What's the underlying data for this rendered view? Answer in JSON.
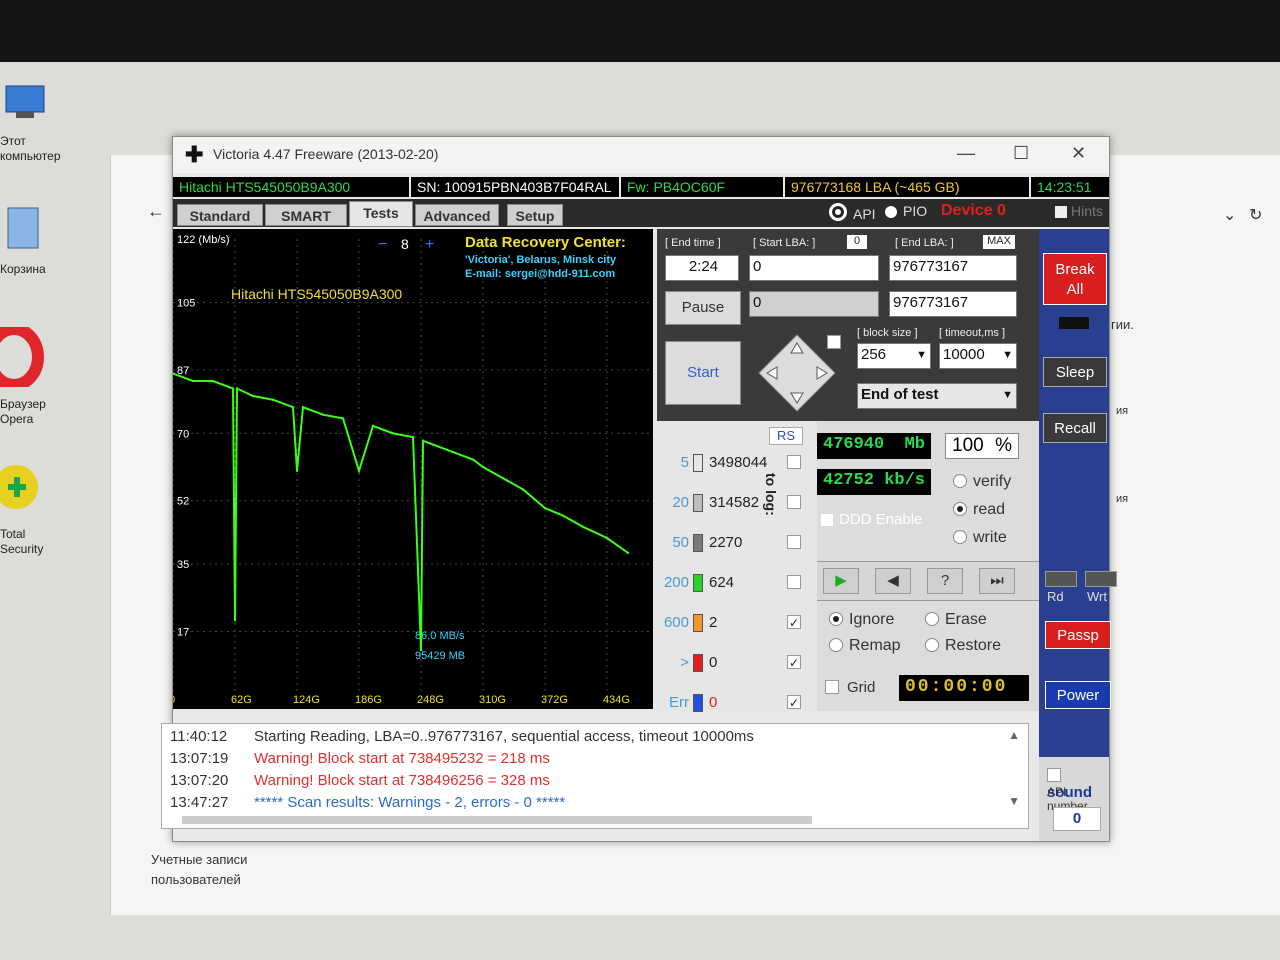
{
  "desktop": {
    "icons": [
      {
        "label": "Этот компьютер",
        "icon": "computer-icon"
      },
      {
        "label": "Корзина",
        "icon": "recycle-bin-icon"
      },
      {
        "label": "Браузер Opera",
        "icon": "opera-icon"
      },
      {
        "label": "Total Security",
        "icon": "total-security-icon"
      }
    ]
  },
  "background_window": {
    "text_accounts": "Учетные записи\nпользователей",
    "text_gii": "гии.",
    "text_ya1": "ия",
    "text_ya2": "ия"
  },
  "window": {
    "title": "Victoria 4.47  Freeware (2013-02-20)",
    "controls": {
      "minimize": "—",
      "maximize": "☐",
      "close": "✕"
    }
  },
  "infobar": {
    "model": "Hitachi HTS545050B9A300",
    "serial": "SN: 100915PBN403B7F04RAL",
    "firmware": "Fw: PB4OC60F",
    "capacity": "976773168 LBA (~465 GB)",
    "time": "14:23:51"
  },
  "tabs": [
    "Standard",
    "SMART",
    "Tests",
    "Advanced",
    "Setup"
  ],
  "active_tab": "Tests",
  "mode": {
    "api": "API",
    "pio": "PIO",
    "device": "Device 0",
    "hints": "Hints"
  },
  "graph": {
    "ylabel": "122 (Mb/s)",
    "yticks": [
      "105",
      "87",
      "70",
      "52",
      "35",
      "17"
    ],
    "xticks": [
      "0",
      "62G",
      "124G",
      "186G",
      "248G",
      "310G",
      "372G",
      "434G"
    ],
    "counter": "8",
    "minus": "−",
    "plus": "+",
    "drive_label": "Hitachi HTS545050B9A300",
    "center_title": "Data Recovery Center:",
    "center_line1": "'Victoria', Belarus, Minsk city",
    "center_line2": "E-mail: sergei@hdd-911.com",
    "speed_readout": "86,0 MB/s",
    "mb_readout": "95429 MB",
    "line_color": "#39ff14"
  },
  "chart_data": {
    "type": "line",
    "title": "",
    "ylabel": "122 (Mb/s)",
    "xlabel": "",
    "xticks": [
      "0",
      "62G",
      "124G",
      "186G",
      "248G",
      "310G",
      "372G",
      "434G"
    ],
    "ylim": [
      0,
      122
    ],
    "x_unit": "G",
    "series": [
      {
        "x": [
          0,
          10,
          20,
          40,
          60,
          62,
          64,
          80,
          100,
          120,
          124,
          130,
          150,
          170,
          186,
          200,
          220,
          240,
          248,
          250,
          260,
          280,
          300,
          310,
          330,
          350,
          372,
          390,
          410,
          434,
          455
        ],
        "y": [
          86,
          85,
          84,
          84,
          82,
          20,
          82,
          80,
          79,
          77,
          60,
          77,
          75,
          74,
          60,
          72,
          70,
          69,
          12,
          68,
          67,
          65,
          63,
          61,
          58,
          55,
          50,
          48,
          45,
          42,
          38
        ]
      }
    ]
  },
  "controls": {
    "end_time_label": "[ End time ]",
    "end_time": "2:24",
    "start_lba_label": "[ Start LBA: ]",
    "start_lba_zero": "0",
    "end_lba_label": "[ End LBA: ]",
    "max": "MAX",
    "start_lba": "0",
    "end_lba": "976773167",
    "cur_lba": "0",
    "cur_end_lba": "976773167",
    "pause": "Pause",
    "start": "Start",
    "block_size_label": "[ block size ]",
    "timeout_label": "[ timeout,ms ]",
    "block_size": "256",
    "timeout": "10000",
    "end_action": "End of test"
  },
  "stats": {
    "rs": "RS",
    "to_log": "to log:",
    "rows": [
      {
        "threshold": "5",
        "count": "3498044",
        "color": "#e6e6e6",
        "log": false
      },
      {
        "threshold": "20",
        "count": "314582",
        "color": "#bdbdbd",
        "log": false
      },
      {
        "threshold": "50",
        "count": "2270",
        "color": "#7a7a7a",
        "log": false
      },
      {
        "threshold": "200",
        "count": "624",
        "color": "#2bd02b",
        "log": false
      },
      {
        "threshold": "600",
        "count": "2",
        "color": "#f2962a",
        "log": true
      },
      {
        "threshold": ">",
        "count": "0",
        "color": "#e02020",
        "log": true
      },
      {
        "threshold": "Err",
        "count": "0",
        "color": "#2050e0",
        "log": true
      }
    ]
  },
  "readouts": {
    "mb": "476940",
    "mb_unit": "Mb",
    "percent": "100",
    "percent_unit": "%",
    "speed": "42752",
    "speed_unit": "kb/s",
    "ddd": "DDD Enable",
    "verify": "verify",
    "read": "read",
    "write": "write",
    "ignore": "Ignore",
    "erase": "Erase",
    "remap": "Remap",
    "restore": "Restore",
    "grid": "Grid",
    "timer": "00:00:00"
  },
  "sidebar": {
    "break_all": "Break\nAll",
    "sleep": "Sleep",
    "recall": "Recall",
    "rd": "Rd",
    "wrt": "Wrt",
    "passp": "Passp",
    "power": "Power",
    "sound": "sound",
    "api_number": "API number",
    "api_value": "0"
  },
  "log": [
    {
      "time": "11:40:12",
      "text": "Starting Reading, LBA=0..976773167, sequential access, timeout 10000ms",
      "color": "#333333"
    },
    {
      "time": "13:07:19",
      "text": "Warning! Block start at 738495232 = 218 ms",
      "color": "#e03030"
    },
    {
      "time": "13:07:20",
      "text": "Warning! Block start at 738496256 = 328 ms",
      "color": "#e03030"
    },
    {
      "time": "13:47:27",
      "text": "***** Scan results: Warnings - 2, errors - 0 *****",
      "color": "#2a6ad0"
    }
  ]
}
